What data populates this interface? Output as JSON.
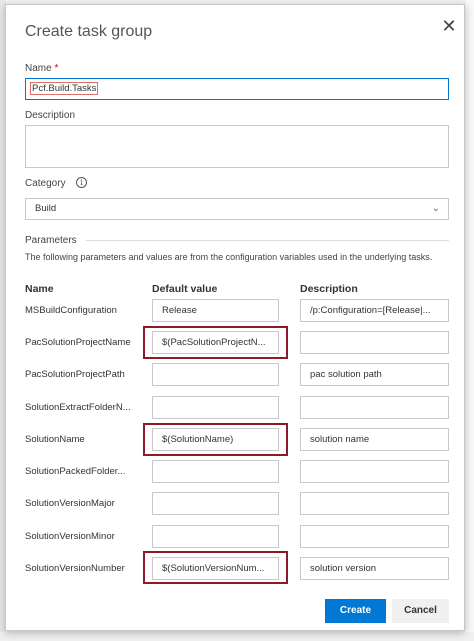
{
  "dialog": {
    "title": "Create task group",
    "close_icon": "close-icon"
  },
  "form": {
    "name_label": "Name",
    "name_required_marker": "*",
    "name_value": "Pcf.Build.Tasks",
    "description_label": "Description",
    "description_value": "",
    "category_label": "Category",
    "category_value": "Build"
  },
  "parameters": {
    "title": "Parameters",
    "description": "The following parameters and values are from the configuration variables used in the underlying tasks.",
    "headers": {
      "name": "Name",
      "default_value": "Default value",
      "description": "Description"
    },
    "rows": [
      {
        "name": "MSBuildConfiguration",
        "default_value": "Release",
        "description": "/p:Configuration=[Release|..."
      },
      {
        "name": "PacSolutionProjectName",
        "default_value": "$(PacSolutionProjectN...",
        "description": ""
      },
      {
        "name": "PacSolutionProjectPath",
        "default_value": "",
        "description": "pac solution path"
      },
      {
        "name": "SolutionExtractFolderN...",
        "default_value": "",
        "description": ""
      },
      {
        "name": "SolutionName",
        "default_value": "$(SolutionName)",
        "description": "solution name"
      },
      {
        "name": "SolutionPackedFolder...",
        "default_value": "",
        "description": ""
      },
      {
        "name": "SolutionVersionMajor",
        "default_value": "",
        "description": ""
      },
      {
        "name": "SolutionVersionMinor",
        "default_value": "",
        "description": ""
      },
      {
        "name": "SolutionVersionNumber",
        "default_value": "$(SolutionVersionNum...",
        "description": "solution version"
      }
    ]
  },
  "buttons": {
    "create": "Create",
    "cancel": "Cancel"
  },
  "colors": {
    "accent": "#0078d4",
    "highlight": "#8b1a2b"
  }
}
